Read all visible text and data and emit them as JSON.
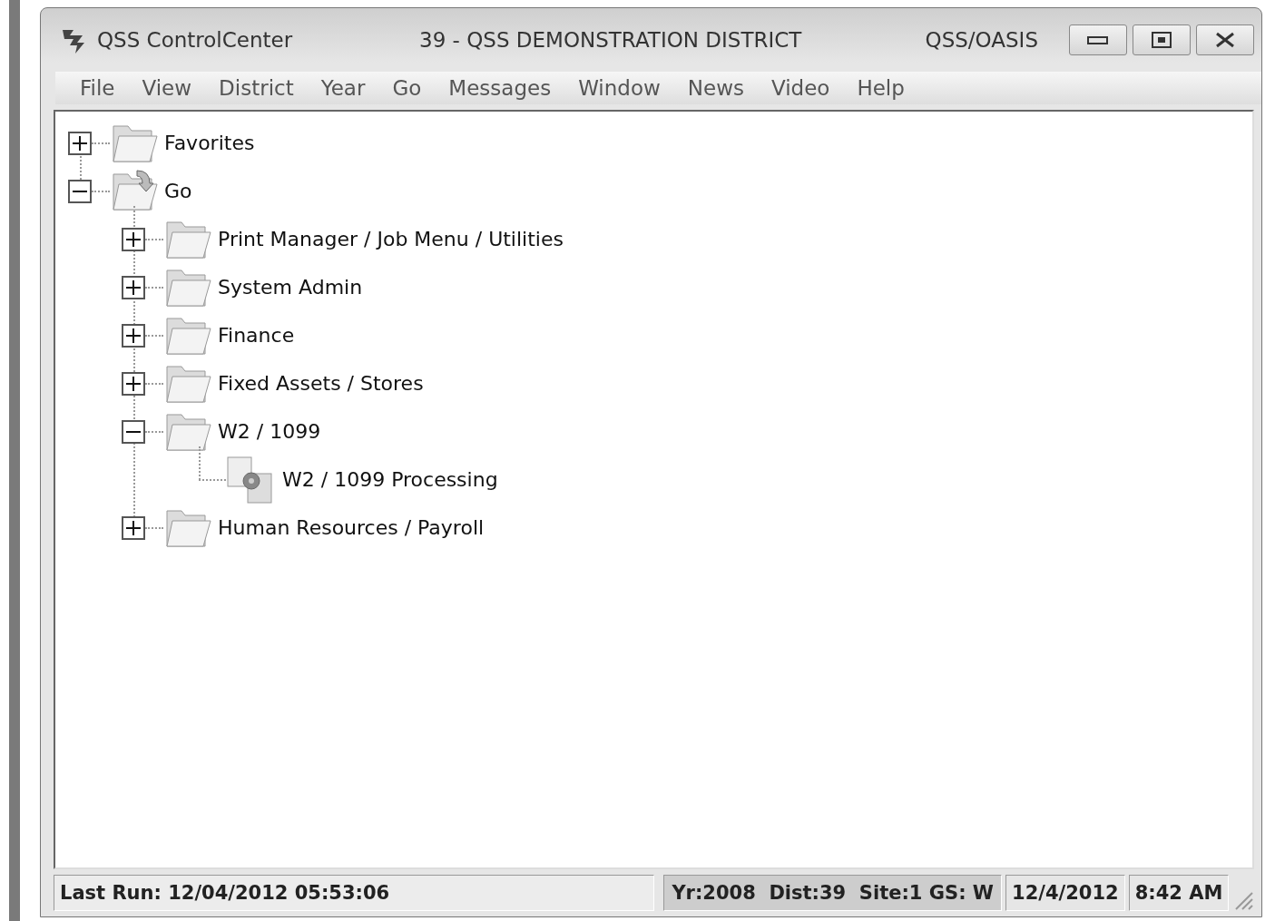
{
  "window": {
    "app_title": "QSS ControlCenter",
    "district": "39 - QSS DEMONSTRATION DISTRICT",
    "system": "QSS/OASIS"
  },
  "menu": [
    "File",
    "View",
    "District",
    "Year",
    "Go",
    "Messages",
    "Window",
    "News",
    "Video",
    "Help"
  ],
  "tree": [
    {
      "label": "Favorites",
      "kind": "folder",
      "expanded": false
    },
    {
      "label": "Go",
      "kind": "go-folder",
      "expanded": true,
      "children": [
        {
          "label": "Print Manager / Job Menu / Utilities",
          "kind": "folder",
          "expanded": false
        },
        {
          "label": "System Admin",
          "kind": "folder",
          "expanded": false
        },
        {
          "label": "Finance",
          "kind": "folder",
          "expanded": false
        },
        {
          "label": "Fixed Assets / Stores",
          "kind": "folder",
          "expanded": false
        },
        {
          "label": "W2 / 1099",
          "kind": "folder",
          "expanded": true,
          "children": [
            {
              "label": "W2 / 1099 Processing",
              "kind": "program"
            }
          ]
        },
        {
          "label": "Human Resources / Payroll",
          "kind": "folder",
          "expanded": false
        }
      ]
    }
  ],
  "status_bar": {
    "last_run": "Last Run: 12/04/2012 05:53:06",
    "context": "Yr:2008  Dist:39  Site:1 GS: W",
    "date": "12/4/2012",
    "time": "8:42 AM"
  }
}
